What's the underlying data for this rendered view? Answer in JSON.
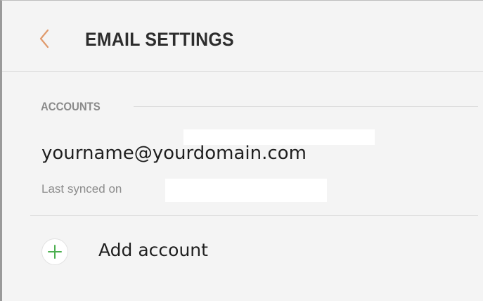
{
  "header": {
    "back_icon": "chevron-left-icon",
    "title": "EMAIL SETTINGS"
  },
  "accounts": {
    "section_label": "ACCOUNTS",
    "items": [
      {
        "email": "yourname@yourdomain.com",
        "sync_label": "Last synced on",
        "sync_value": ""
      }
    ],
    "add_label": "Add account",
    "add_icon": "plus-icon"
  },
  "colors": {
    "accent": "#e09a6c",
    "add_icon": "#4caf50",
    "background": "#f4f4f4",
    "title": "#2d2d2d",
    "section_label": "#8a8a8a",
    "secondary_text": "#8c8c8c"
  }
}
